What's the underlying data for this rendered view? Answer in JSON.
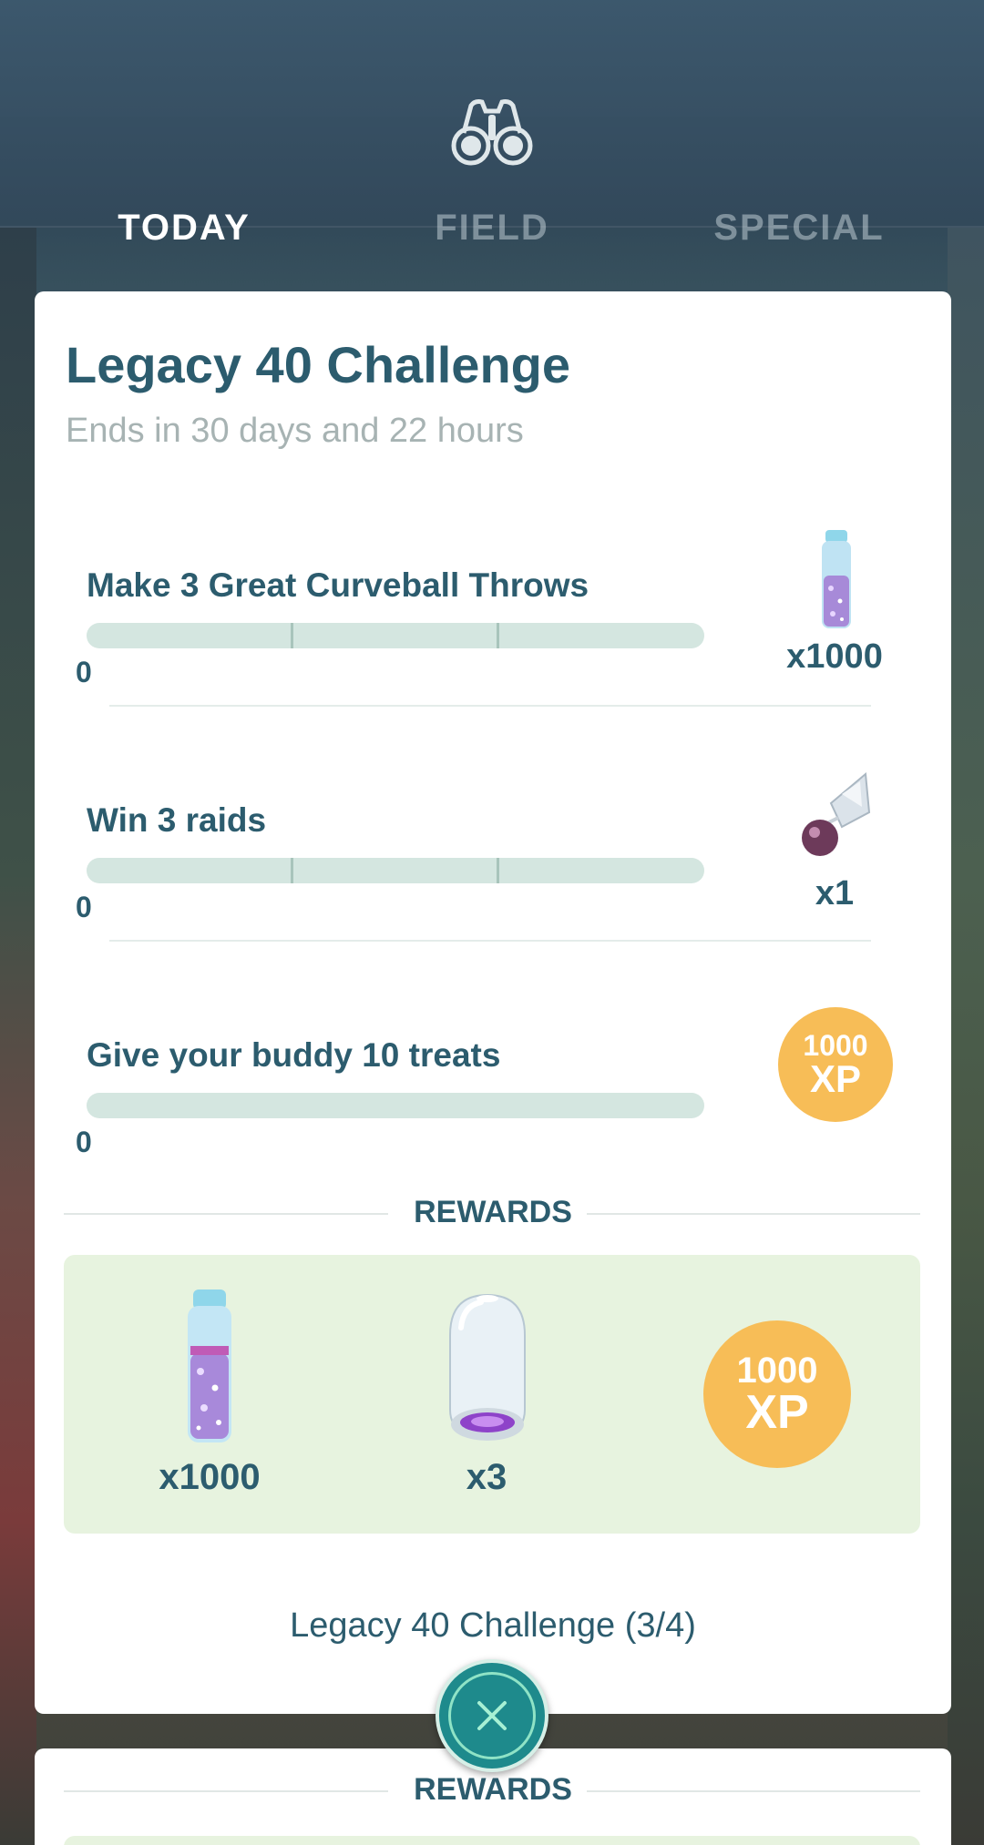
{
  "tabs": {
    "today": "TODAY",
    "field": "FIELD",
    "special": "SPECIAL",
    "active": "today"
  },
  "header": {
    "icon": "binoculars-icon"
  },
  "challenge": {
    "title": "Legacy 40 Challenge",
    "subtitle": "Ends in 30 days and 22 hours",
    "tasks": [
      {
        "label": "Make 3 Great Curveball Throws",
        "progress": "0",
        "progress_fraction": 0,
        "reward_icon": "stardust-icon",
        "reward_qty": "x1000"
      },
      {
        "label": "Win 3 raids",
        "progress": "0",
        "progress_fraction": 0,
        "reward_icon": "sinnoh-stone-icon",
        "reward_qty": "x1"
      },
      {
        "label": "Give your buddy 10 treats",
        "progress": "0",
        "progress_fraction": 0,
        "reward_icon": "xp-badge",
        "reward_xp_amount": "1000",
        "reward_xp_unit": "XP"
      }
    ],
    "rewards_heading": "REWARDS",
    "rewards": [
      {
        "icon": "stardust-icon",
        "qty": "x1000"
      },
      {
        "icon": "incubator-icon",
        "qty": "x3"
      },
      {
        "icon": "xp-badge",
        "amount": "1000",
        "unit": "XP"
      }
    ],
    "footer": "Legacy 40 Challenge (3/4)"
  },
  "next_card": {
    "rewards_heading": "REWARDS"
  },
  "colors": {
    "accent_text": "#2c5c6e",
    "xp_badge": "#f7bd57",
    "rewards_bg": "#e7f3df",
    "progress_track": "#d4e6e0",
    "close_button": "#1e8a8c"
  }
}
